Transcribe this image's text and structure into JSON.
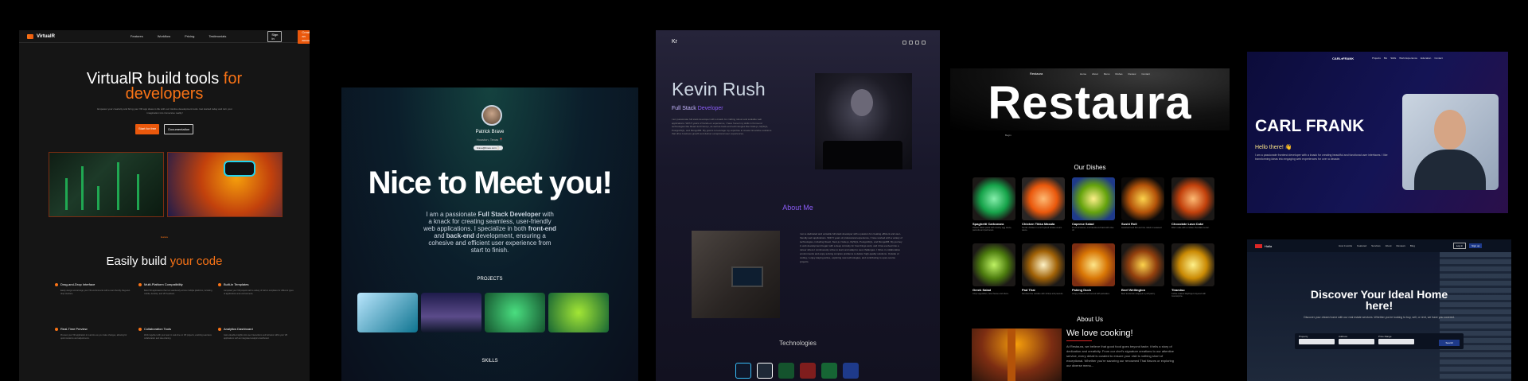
{
  "panel_virtualr": {
    "logo": "VirtualR",
    "nav_links": [
      "Features",
      "Workflow",
      "Pricing",
      "Testimonials"
    ],
    "sign_in": "Sign In",
    "create_account": "Create an account",
    "hero_title_1": "VirtualR build tools",
    "hero_title_accent_1": "for",
    "hero_title_accent_2": "developers",
    "hero_sub": "Empower your creativity and bring your VR app ideas to life with our intuitive development tools. Get started today and turn your imagination into immersive reality!",
    "start_free": "Start for free",
    "documentation": "Documentation",
    "feature_tag": "feature",
    "section_title": "Easily build",
    "section_title_accent": "your code",
    "features": [
      {
        "title": "Drag-and-Drop Interface",
        "desc": "Easily design and arrange your VR environments with a user-friendly drag-and-drop interface."
      },
      {
        "title": "Multi-Platform Compatibility",
        "desc": "Build VR applications that run seamlessly across multiple platforms, including mobile, desktop, and VR headsets."
      },
      {
        "title": "Built-in Templates",
        "desc": "Jumpstart your VR projects with a variety of built-in templates for different types of applications and environments."
      },
      {
        "title": "Real-Time Preview",
        "desc": "Preview your VR application in real-time as you make changes, allowing for quick iterations and adjustments."
      },
      {
        "title": "Collaboration Tools",
        "desc": "Work together with your team in real-time on VR projects, enabling seamless collaboration and idea sharing."
      },
      {
        "title": "Analytics Dashboard",
        "desc": "Gain valuable insights into user interactions and behavior within your VR applications with an integrated analytics dashboard."
      }
    ]
  },
  "panel_patrick": {
    "name": "Patrick Brave",
    "location": "Houston, Texas 📍",
    "badge": "brave@brave.com 📋",
    "title": "Nice to Meet you!",
    "desc_pre": "I am a passionate",
    "desc_role": "Full Stack Developer",
    "desc_mid": "with a knack for creating seamless, user-friendly web applications. I specialize in both",
    "desc_front": "front-end",
    "desc_and": "and",
    "desc_back": "back-end",
    "desc_post": "development, ensuring a cohesive and efficient user experience from start to finish.",
    "projects_label": "PROJECTS",
    "skills_label": "SKILLS",
    "thumb_colors": [
      "#7dd3fc",
      "#5b4b8a",
      "#15803d",
      "#65a30d"
    ]
  },
  "panel_kevin": {
    "logo": "Kr",
    "name": "Kevin Rush",
    "role_1": "Full Stack",
    "role_2": "Developer",
    "desc": "I am passionate full stack developer with a knack for crafting robust and scalable web applications. With 5 years of hands-on experience, I have honed my skills in front-end technologies like React and Next.js, as well as back-end technologies like Node.js, MySQL, PostgreSQL, and MongoDB. My goal is to leverage my expertise to create innovative solutions that drive business growth and deliver exceptional user experiences.",
    "about_1": "About",
    "about_2": "Me",
    "about_text": "I am a dedicated and versatile full stack developer with a passion for creating efficient and user-friendly web applications. With 5 years of professional experience, I have worked with a variety of technologies, including React, Next.js, Node.js, MySQL, PostgreSQL, and MongoDB. My journey in web development began with a deep curiosity for how things work, and it has evolved into a career where I continuously strive to learn and adapt to new challenges. I thrive in collaborative environments and enjoy solving complex problems to deliver high-quality solutions. Outside of coding, I enjoy staying active, exploring new technologies, and contributing to open-source projects.",
    "technologies": "Technologies",
    "tech_colors": [
      "#0f172a",
      "#1f2937",
      "#14532d",
      "#7f1d1d",
      "#166534",
      "#1e3a8a"
    ]
  },
  "panel_restaura": {
    "logo": "Restaura",
    "nav_links": [
      "Home",
      "About",
      "Menu",
      "Dishes",
      "Review",
      "Contact"
    ],
    "title": "Restaura",
    "sub": "Begin",
    "dishes_title": "Our Dishes",
    "dishes": [
      {
        "name": "Spaghetti Carbonara",
        "desc": "Classic Italian pasta with creamy egg sauce, pancetta and parmesan.",
        "color": "#16a34a"
      },
      {
        "name": "Chicken Tikka Masala",
        "desc": "Tender chicken in a rich spiced tomato cream sauce.",
        "color": "#ea580c"
      },
      {
        "name": "Caprese Salad",
        "desc": "Fresh tomatoes, mozzarella and basil with olive oil.",
        "color": "#65a30d"
      },
      {
        "name": "Sushi Roll",
        "desc": "Assorted fresh fish and rice rolled in seaweed.",
        "color": "#b45309"
      },
      {
        "name": "Chocolate Lava Cake",
        "desc": "Warm cake with a molten chocolate center.",
        "color": "#c2410c"
      },
      {
        "name": "Greek Salad",
        "desc": "Crisp vegetables, feta cheese and olives.",
        "color": "#4d7c0f"
      },
      {
        "name": "Pad Thai",
        "desc": "Stir-fried rice noodles with shrimp and peanuts.",
        "color": "#a16207"
      },
      {
        "name": "Paking Duck",
        "desc": "Crispy roasted duck served with pancakes.",
        "color": "#d97706"
      },
      {
        "name": "Beef Wellington",
        "desc": "Beef tenderloin wrapped in puff pastry.",
        "color": "#92400e"
      },
      {
        "name": "Tiramisu",
        "desc": "Coffee-soaked ladyfingers layered with mascarpone.",
        "color": "#ca8a04"
      }
    ],
    "about_title": "About Us",
    "love": "We love cooking!",
    "about_text": "At Restaura, we believe that good food goes beyond taste; it tells a story of dedication and creativity. From our chef's signature creations to our attentive service, every detail is curated to ensure your visit is nothing short of exceptional. Whether you're savoring our renowned Thai flavors or exploring our diverse menu..."
  },
  "panel_carl": {
    "logo": "CARL♦FRANK",
    "nav_links": [
      "Projects",
      "Bio",
      "Skills",
      "Work Experience",
      "Education",
      "Contact"
    ],
    "name": "CARL FRANK",
    "hello": "Hello there! 👋",
    "desc": "I am a passionate frontend developer with a knack for creating beautiful and functional user interfaces. I like transforming ideas into engaging web experiences for over a decade."
  },
  "panel_homes": {
    "logo": "Haila",
    "nav_links": [
      "How it works",
      "Featured",
      "Services",
      "About",
      "Reviews",
      "Blog"
    ],
    "login": "Log in",
    "signup": "Sign up",
    "title_1": "Discover Your Ideal Home",
    "title_2": "here!",
    "sub": "Discover your dream home with our real estate services. Whether you're looking to buy, sell, or rent, we have you covered.",
    "fields": [
      "Property",
      "Address",
      "Price Range"
    ],
    "search": "Search"
  }
}
